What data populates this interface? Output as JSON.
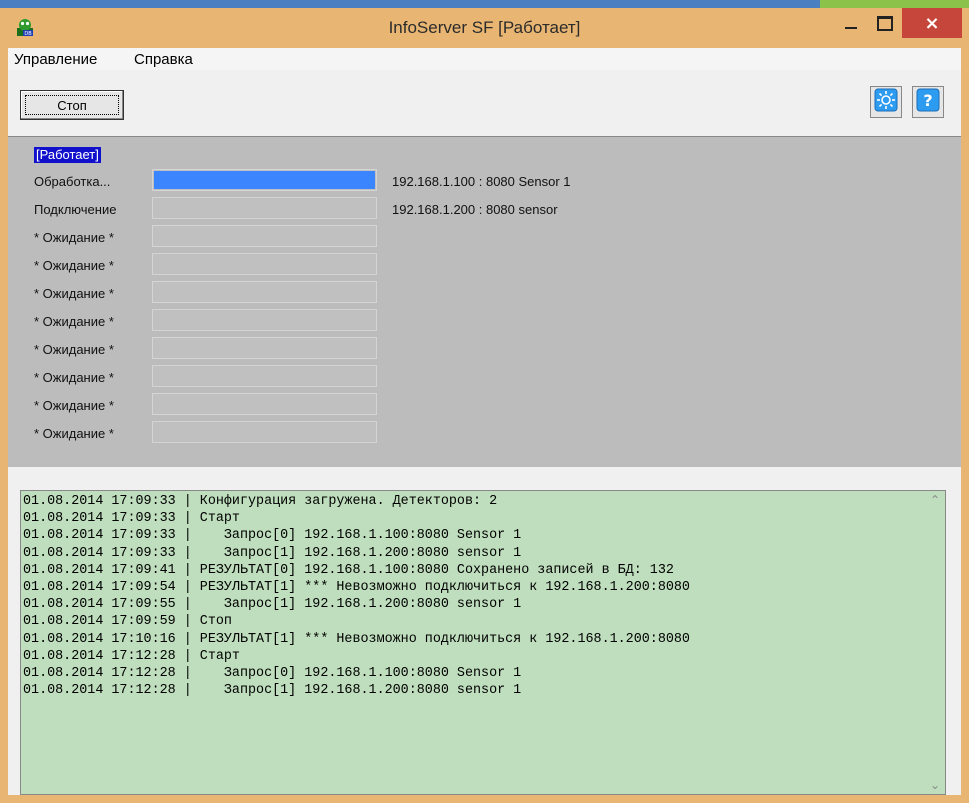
{
  "window": {
    "title": "InfoServer SF [Работает]",
    "close_label": "×"
  },
  "menu": {
    "items": [
      "Управление",
      "Справка"
    ]
  },
  "toolbar": {
    "stop_label": "Стоп"
  },
  "status": {
    "title": "[Работает]",
    "rows": [
      {
        "label": "Обработка...",
        "progress": 1.0,
        "text": "192.168.1.100 : 8080 Sensor 1"
      },
      {
        "label": "Подключение",
        "progress": 0.0,
        "text": "192.168.1.200 : 8080 sensor"
      },
      {
        "label": "* Ожидание *",
        "progress": 0.0,
        "text": ""
      },
      {
        "label": "* Ожидание *",
        "progress": 0.0,
        "text": ""
      },
      {
        "label": "* Ожидание *",
        "progress": 0.0,
        "text": ""
      },
      {
        "label": "* Ожидание *",
        "progress": 0.0,
        "text": ""
      },
      {
        "label": "* Ожидание *",
        "progress": 0.0,
        "text": ""
      },
      {
        "label": "* Ожидание *",
        "progress": 0.0,
        "text": ""
      },
      {
        "label": "* Ожидание *",
        "progress": 0.0,
        "text": ""
      },
      {
        "label": "* Ожидание *",
        "progress": 0.0,
        "text": ""
      }
    ]
  },
  "log": {
    "lines": [
      "01.08.2014 17:09:33 | Конфигурация загружена. Детекторов: 2",
      "01.08.2014 17:09:33 | Старт",
      "01.08.2014 17:09:33 |    Запрос[0] 192.168.1.100:8080 Sensor 1",
      "01.08.2014 17:09:33 |    Запрос[1] 192.168.1.200:8080 sensor 1",
      "01.08.2014 17:09:41 | РЕЗУЛЬТАТ[0] 192.168.1.100:8080 Сохранено записей в БД: 132",
      "01.08.2014 17:09:54 | РЕЗУЛЬТАТ[1] *** Невозможно подключиться к 192.168.1.200:8080",
      "01.08.2014 17:09:55 |    Запрос[1] 192.168.1.200:8080 sensor 1",
      "01.08.2014 17:09:59 | Стоп",
      "01.08.2014 17:10:16 | РЕЗУЛЬТАТ[1] *** Невозможно подключиться к 192.168.1.200:8080",
      "01.08.2014 17:12:28 | Старт",
      "01.08.2014 17:12:28 |    Запрос[0] 192.168.1.100:8080 Sensor 1",
      "01.08.2014 17:12:28 |    Запрос[1] 192.168.1.200:8080 sensor 1"
    ]
  },
  "icons": {
    "app": "app-icon",
    "settings": "settings-icon",
    "help": "help-icon"
  },
  "colors": {
    "title_bar": "#e8b672",
    "close_button": "#c7463c",
    "status_background": "#bcbcbc",
    "progress_fill": "#3b86ff",
    "status_badge": "#1010cc",
    "log_background": "#bfdebd"
  }
}
